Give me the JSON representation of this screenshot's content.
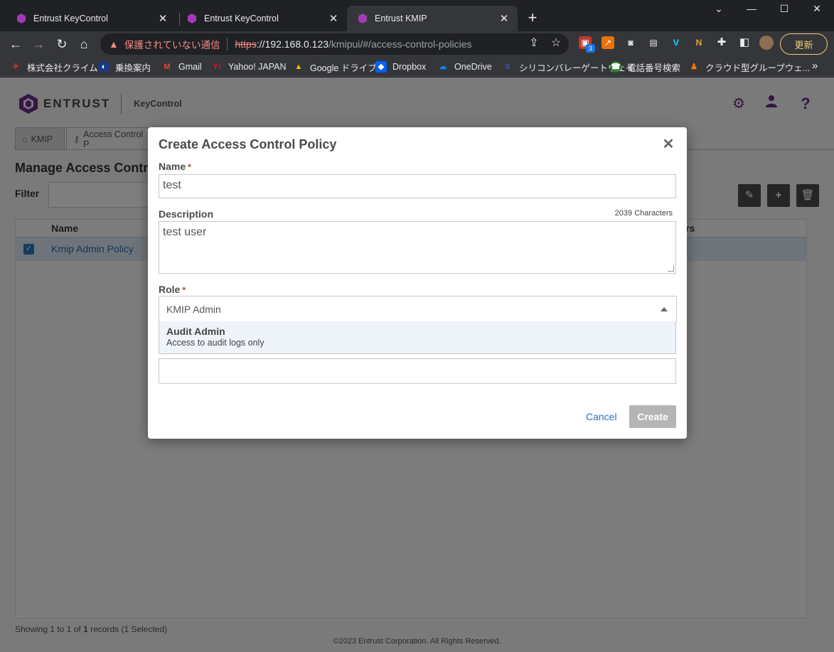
{
  "browser": {
    "tabs": [
      {
        "title": "Entrust KeyControl",
        "active": false
      },
      {
        "title": "Entrust KeyControl",
        "active": false
      },
      {
        "title": "Entrust KMIP",
        "active": true
      }
    ],
    "address": {
      "security_label": "保護されていない通信",
      "scheme": "https",
      "host": "://192.168.0.123",
      "path": "/kmipui/#/access-control-policies"
    },
    "update_label": "更新",
    "extension_badge": "3",
    "bookmarks": [
      "株式会社クライム",
      "乗換案内",
      "Gmail",
      "Yahoo! JAPAN",
      "Google ドライブ",
      "Dropbox",
      "OneDrive",
      "シリコンバレーゲートウェイ",
      "電話番号検索",
      "クラウド型グループウェ..."
    ]
  },
  "app": {
    "logo_word": "ENTRUST",
    "product": "KeyControl",
    "page_tabs": [
      "KMIP",
      "Access Control P"
    ],
    "page_title": "Manage Access Contr",
    "filter_label": "Filter",
    "grid": {
      "columns": [
        "Name",
        "rs"
      ],
      "rows": [
        {
          "name": "Kmip Admin Policy",
          "checked": true
        }
      ]
    },
    "status": {
      "prefix": "Showing 1 to 1 of ",
      "count": "1",
      "suffix": " records (1 Selected)"
    },
    "copyright": "©2023 Entrust Corporation. All Rights Reserved."
  },
  "modal": {
    "title": "Create Access Control Policy",
    "name_label": "Name",
    "required_mark": "*",
    "name_value": "test",
    "description_label": "Description",
    "char_count": "2039 Characters",
    "description_value": "test user",
    "role_label": "Role",
    "role_selected": "KMIP Admin",
    "role_option": {
      "title": "Audit Admin",
      "description": "Access to audit logs only"
    },
    "cancel_label": "Cancel",
    "create_label": "Create"
  },
  "colors": {
    "brand": "#6b2d8a",
    "link": "#2b6fb5",
    "required": "#c0392b"
  }
}
